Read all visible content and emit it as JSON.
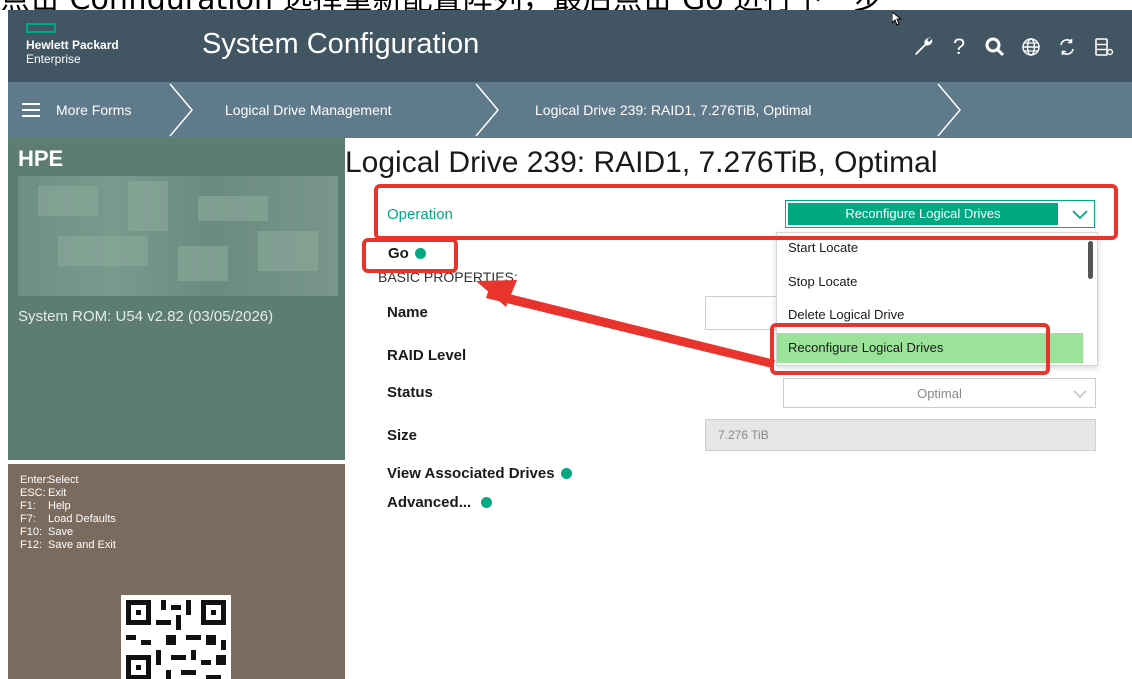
{
  "caption": {
    "text": "点击 Configuration 选择重新配置阵列，最后点击 Go 进行下一步"
  },
  "header": {
    "brand_line1": "Hewlett Packard",
    "brand_line2": "Enterprise",
    "title": "System Configuration",
    "icons": [
      "wrench-icon",
      "help-icon",
      "search-icon",
      "globe-icon",
      "refresh-icon",
      "server-icon"
    ],
    "help_glyph": "?"
  },
  "nav": {
    "menu_label": "More Forms",
    "crumbs": [
      "Logical Drive Management",
      "Logical Drive 239: RAID1, 7.276TiB, Optimal"
    ]
  },
  "sidebar": {
    "system_title": "HPE",
    "rom": "System ROM: U54 v2.82 (03/05/2026)",
    "keys": [
      {
        "key": "Enter:",
        "action": "Select"
      },
      {
        "key": "ESC:",
        "action": "Exit"
      },
      {
        "key": "F1:",
        "action": "Help"
      },
      {
        "key": "F7:",
        "action": "Load Defaults"
      },
      {
        "key": "F10:",
        "action": "Save"
      },
      {
        "key": "F12:",
        "action": "Save and Exit"
      }
    ]
  },
  "main": {
    "title": "Logical Drive 239: RAID1, 7.276TiB, Optimal",
    "operation_label": "Operation",
    "operation_value": "Reconfigure Logical Drives",
    "go_label": "Go",
    "section_label": "BASIC PROPERTIES:",
    "name_label": "Name",
    "raid_label": "RAID Level",
    "status_label": "Status",
    "status_value": "Optimal",
    "size_label": "Size",
    "size_value": "7.276 TiB",
    "view_drives_label": "View Associated Drives",
    "advanced_label": "Advanced...",
    "dropdown_options": [
      "Start Locate",
      "Stop Locate",
      "Delete Logical Drive",
      "Reconfigure Logical Drives"
    ],
    "dropdown_selected_index": 3
  },
  "colors": {
    "header_bg": "#425563",
    "nav_bg": "#5f7a8b",
    "accent_green": "#01a982",
    "selected_green": "#9be29a",
    "annotation_red": "#e8342c"
  }
}
